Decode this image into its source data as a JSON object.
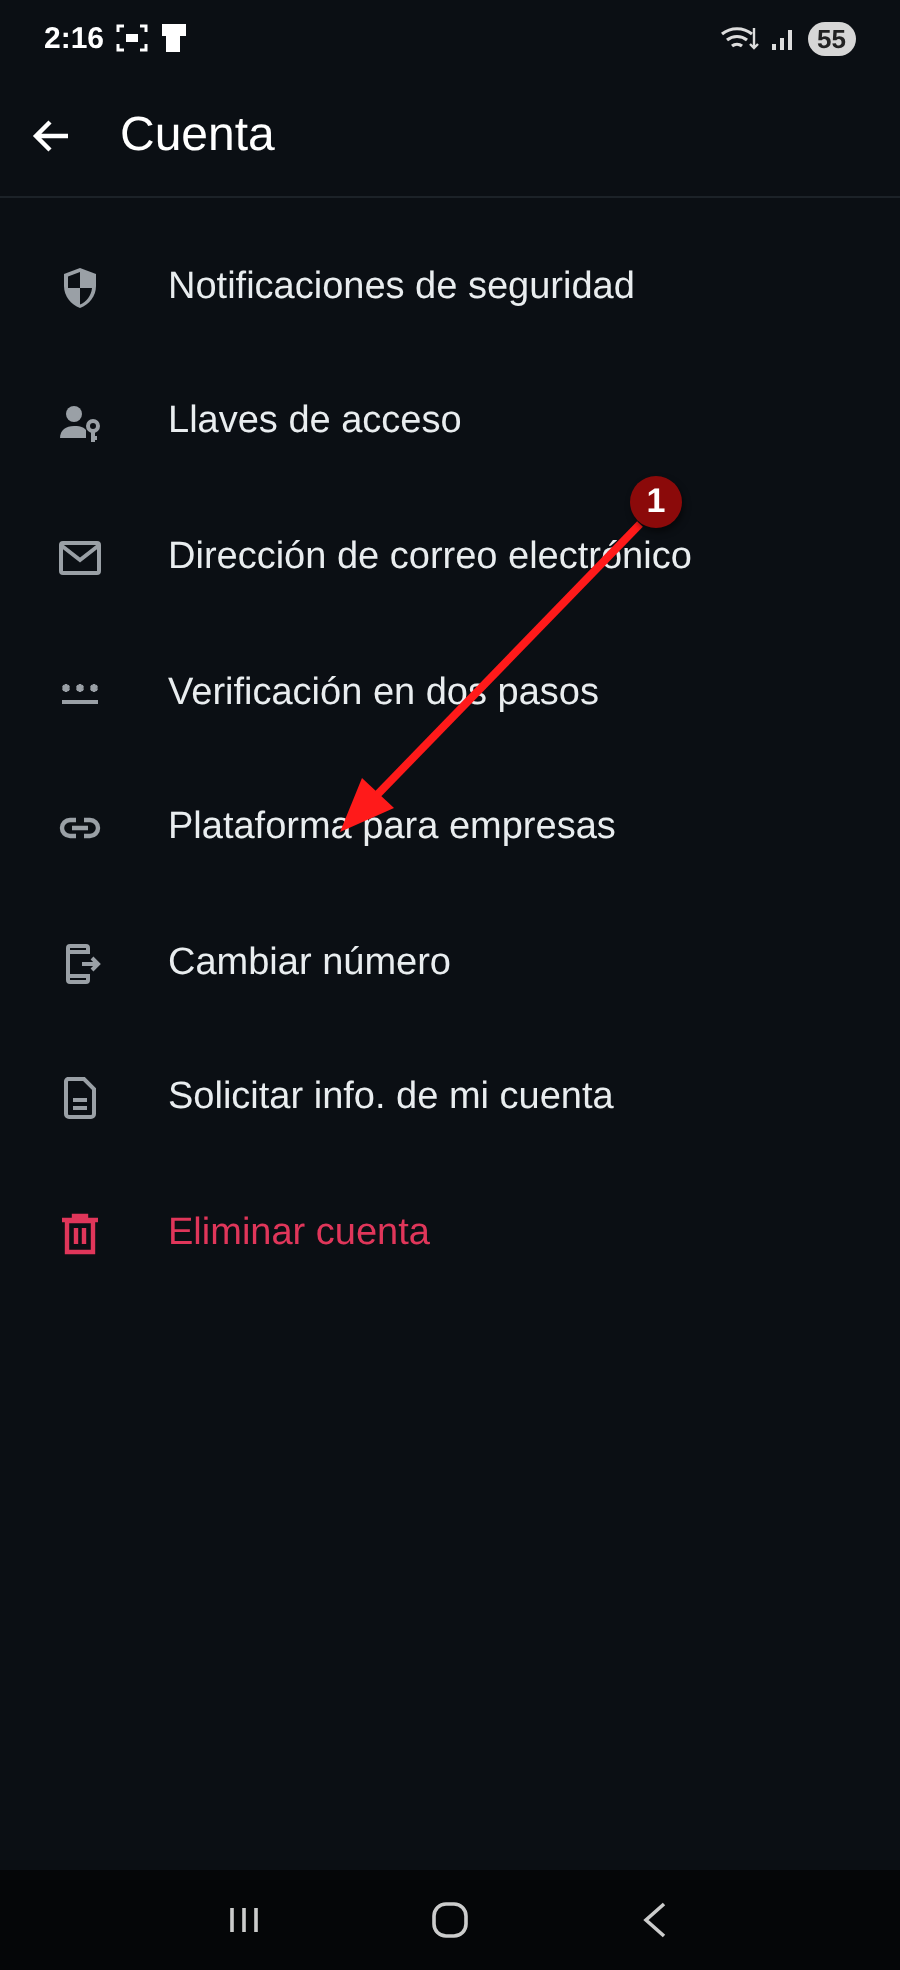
{
  "status_bar": {
    "time": "2:16",
    "battery": "55"
  },
  "header": {
    "title": "Cuenta"
  },
  "items": [
    {
      "label": "Notificaciones de seguridad",
      "kind": "normal"
    },
    {
      "label": "Llaves de acceso",
      "kind": "normal"
    },
    {
      "label": "Dirección de correo electrónico",
      "kind": "normal"
    },
    {
      "label": "Verificación en dos pasos",
      "kind": "normal"
    },
    {
      "label": "Plataforma para empresas",
      "kind": "normal"
    },
    {
      "label": "Cambiar número",
      "kind": "normal"
    },
    {
      "label": "Solicitar info. de mi cuenta",
      "kind": "normal"
    },
    {
      "label": "Eliminar cuenta",
      "kind": "danger"
    }
  ],
  "annotation": {
    "badge": "1"
  }
}
